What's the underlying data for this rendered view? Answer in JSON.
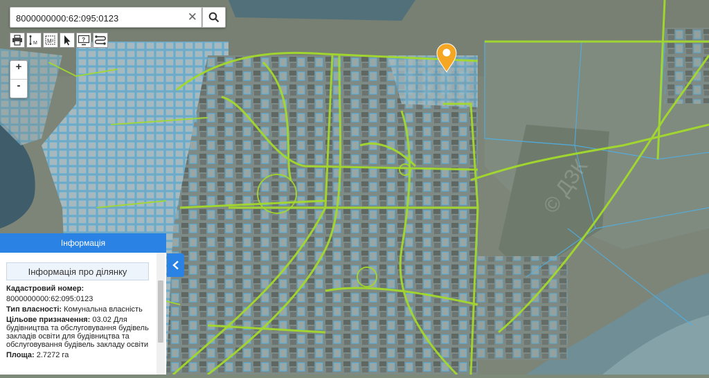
{
  "search": {
    "value": "8000000000:62:095:0123",
    "clear_symbol": "✕"
  },
  "toolbar": {
    "tools": [
      {
        "name": "print-icon"
      },
      {
        "name": "measure-line-icon",
        "label": "M"
      },
      {
        "name": "measure-area-icon",
        "label": "M²"
      },
      {
        "name": "pointer-icon"
      },
      {
        "name": "identify-icon",
        "label": "?"
      },
      {
        "name": "route-icon"
      }
    ]
  },
  "zoom": {
    "in_label": "+",
    "out_label": "-"
  },
  "map": {
    "watermark": "© ДЗК"
  },
  "info_panel": {
    "title": "Інформація",
    "subtitle": "Інформація про ділянку",
    "cadastral_label": "Кадастровий номер:",
    "cadastral_value": "8000000000:62:095:0123",
    "ownership_label": "Тип власності:",
    "ownership_value": "Комунальна власність",
    "purpose_label": "Цільове призначення:",
    "purpose_value": "03.02 Для будівництва та обслуговування будівель закладів освіти для будівництва та обслуговування будівель закладу освіти",
    "area_label": "Площа:",
    "area_value": "2.7272 га"
  },
  "colors": {
    "accent": "#2a82e4",
    "parcel_outline": "#4fb0e6",
    "road_line": "#a3d92c",
    "marker": "#f5a623"
  }
}
